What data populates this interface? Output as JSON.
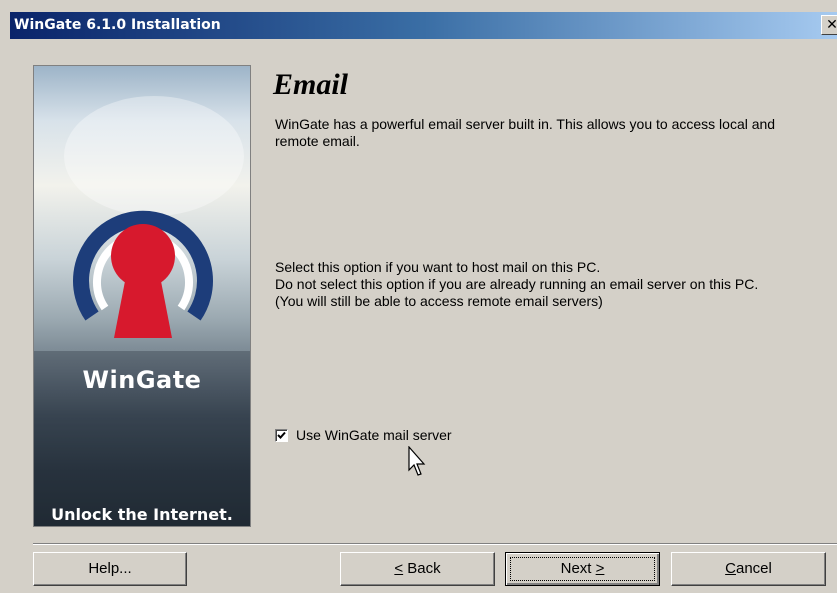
{
  "window": {
    "title": "WinGate 6.1.0 Installation",
    "close_glyph": "✕"
  },
  "banner": {
    "brand": "WinGate",
    "tagline": "Unlock the Internet."
  },
  "page": {
    "heading": "Email",
    "intro": "WinGate has a powerful email server built in. This allows you to access local and remote email.",
    "option_lines": [
      "Select this option if you want to host mail on this PC.",
      "Do not select this option if you are already running an email server on this PC.",
      "(You will still be able to access remote email servers)"
    ]
  },
  "option": {
    "label": "Use WinGate mail server",
    "checked": true
  },
  "buttons": {
    "help": "Help...",
    "back_mnemonic": "<",
    "back_rest": " Back",
    "next_main": "Next ",
    "next_mnemonic": ">",
    "cancel_mnemonic": "C",
    "cancel_rest": "ancel"
  },
  "colors": {
    "titlebar_start": "#0a246a",
    "titlebar_end": "#a6caf0",
    "logo_blue": "#1d3d7a",
    "logo_red": "#d7192d"
  }
}
